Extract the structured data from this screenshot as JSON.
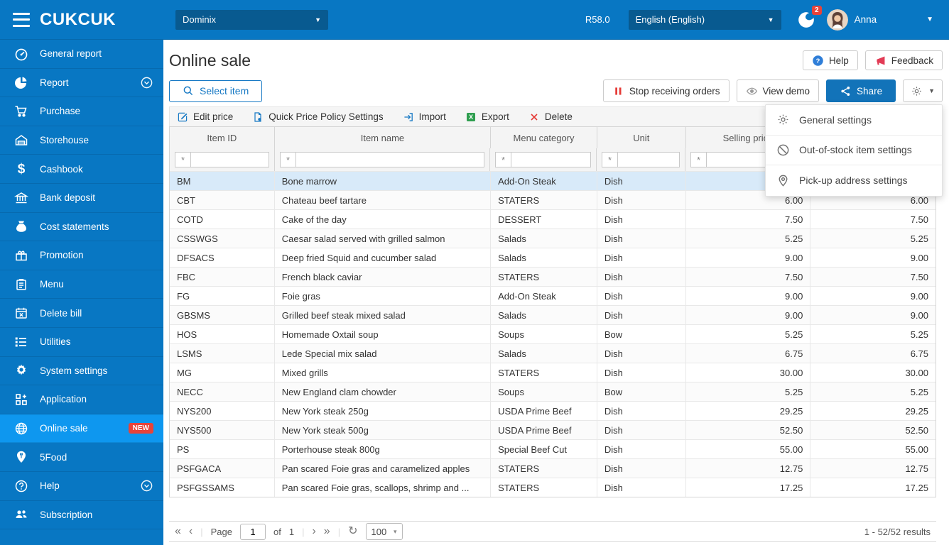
{
  "topbar": {
    "logo": "CUKCUK",
    "branch_selector": "Dominix",
    "version": "R58.0",
    "language_selector": "English (English)",
    "notification_count": "2",
    "user_name": "Anna"
  },
  "sidebar": {
    "items": [
      {
        "label": "General report",
        "icon": "gauge-icon"
      },
      {
        "label": "Report",
        "icon": "pie-chart-icon",
        "chevron": true
      },
      {
        "label": "Purchase",
        "icon": "cart-icon"
      },
      {
        "label": "Storehouse",
        "icon": "warehouse-icon"
      },
      {
        "label": "Cashbook",
        "icon": "dollar-icon"
      },
      {
        "label": "Bank deposit",
        "icon": "bank-icon"
      },
      {
        "label": "Cost statements",
        "icon": "moneybag-icon"
      },
      {
        "label": "Promotion",
        "icon": "gift-icon"
      },
      {
        "label": "Menu",
        "icon": "clipboard-icon"
      },
      {
        "label": "Delete bill",
        "icon": "calendar-x-icon"
      },
      {
        "label": "Utilities",
        "icon": "list-icon"
      },
      {
        "label": "System settings",
        "icon": "gear-icon"
      },
      {
        "label": "Application",
        "icon": "grid-plus-icon"
      },
      {
        "label": "Online sale",
        "icon": "globe-icon",
        "active": true,
        "badge": "NEW"
      },
      {
        "label": "5Food",
        "icon": "pin-fork-icon"
      },
      {
        "label": "Help",
        "icon": "question-circle-icon",
        "chevron": true
      },
      {
        "label": "Subscription",
        "icon": "users-icon"
      }
    ]
  },
  "header": {
    "title": "Online sale",
    "help_label": "Help",
    "feedback_label": "Feedback"
  },
  "actions": {
    "select_item_label": "Select item",
    "stop_orders_label": "Stop receiving orders",
    "view_demo_label": "View demo",
    "share_label": "Share"
  },
  "toolbar": {
    "buttons": [
      {
        "label": "Edit price",
        "icon": "edit-icon"
      },
      {
        "label": "Quick Price Policy Settings",
        "icon": "doc-settings-icon"
      },
      {
        "label": "Import",
        "icon": "import-icon"
      },
      {
        "label": "Export",
        "icon": "excel-icon"
      },
      {
        "label": "Delete",
        "icon": "delete-x-icon"
      }
    ]
  },
  "settings_menu": {
    "items": [
      {
        "label": "General settings",
        "icon": "gear-outline-icon"
      },
      {
        "label": "Out-of-stock item settings",
        "icon": "ban-icon"
      },
      {
        "label": "Pick-up address settings",
        "icon": "pin-icon"
      }
    ]
  },
  "table": {
    "columns": [
      {
        "label": "Item ID",
        "align": "left"
      },
      {
        "label": "Item name",
        "align": "left"
      },
      {
        "label": "Menu category",
        "align": "left"
      },
      {
        "label": "Unit",
        "align": "left"
      },
      {
        "label": "Selling price",
        "align": "right"
      },
      {
        "label": "",
        "align": "right"
      }
    ],
    "filter_operator": "*",
    "selected_row_id": "BM",
    "rows": [
      {
        "id": "BM",
        "name": "Bone marrow",
        "category": "Add-On Steak",
        "unit": "Dish",
        "price": "",
        "price2": ""
      },
      {
        "id": "CBT",
        "name": "Chateau beef tartare",
        "category": "STATERS",
        "unit": "Dish",
        "price": "6.00",
        "price2": "6.00"
      },
      {
        "id": "COTD",
        "name": "Cake of the day",
        "category": "DESSERT",
        "unit": "Dish",
        "price": "7.50",
        "price2": "7.50"
      },
      {
        "id": "CSSWGS",
        "name": "Caesar salad served with grilled salmon",
        "category": "Salads",
        "unit": "Dish",
        "price": "5.25",
        "price2": "5.25"
      },
      {
        "id": "DFSACS",
        "name": "Deep fried Squid and cucumber salad",
        "category": "Salads",
        "unit": "Dish",
        "price": "9.00",
        "price2": "9.00"
      },
      {
        "id": "FBC",
        "name": "French black caviar",
        "category": "STATERS",
        "unit": "Dish",
        "price": "7.50",
        "price2": "7.50"
      },
      {
        "id": "FG",
        "name": "Foie gras",
        "category": "Add-On Steak",
        "unit": "Dish",
        "price": "9.00",
        "price2": "9.00"
      },
      {
        "id": "GBSMS",
        "name": "Grilled beef steak mixed salad",
        "category": "Salads",
        "unit": "Dish",
        "price": "9.00",
        "price2": "9.00"
      },
      {
        "id": "HOS",
        "name": "Homemade Oxtail soup",
        "category": "Soups",
        "unit": "Bow",
        "price": "5.25",
        "price2": "5.25"
      },
      {
        "id": "LSMS",
        "name": "Lede Special mix salad",
        "category": "Salads",
        "unit": "Dish",
        "price": "6.75",
        "price2": "6.75"
      },
      {
        "id": "MG",
        "name": "Mixed grills",
        "category": "STATERS",
        "unit": "Dish",
        "price": "30.00",
        "price2": "30.00"
      },
      {
        "id": "NECC",
        "name": "New England clam chowder",
        "category": "Soups",
        "unit": "Bow",
        "price": "5.25",
        "price2": "5.25"
      },
      {
        "id": "NYS200",
        "name": "New York steak 250g",
        "category": "USDA Prime Beef",
        "unit": "Dish",
        "price": "29.25",
        "price2": "29.25"
      },
      {
        "id": "NYS500",
        "name": "New York steak 500g",
        "category": "USDA Prime Beef",
        "unit": "Dish",
        "price": "52.50",
        "price2": "52.50"
      },
      {
        "id": "PS",
        "name": "Porterhouse steak 800g",
        "category": "Special Beef Cut",
        "unit": "Dish",
        "price": "55.00",
        "price2": "55.00"
      },
      {
        "id": "PSFGACA",
        "name": "Pan scared Foie gras and caramelized apples",
        "category": "STATERS",
        "unit": "Dish",
        "price": "12.75",
        "price2": "12.75"
      },
      {
        "id": "PSFGSSAMS",
        "name": "Pan scared Foie gras, scallops, shrimp and ...",
        "category": "STATERS",
        "unit": "Dish",
        "price": "17.25",
        "price2": "17.25"
      }
    ]
  },
  "pagination": {
    "page_label": "Page",
    "page_value": "1",
    "of_label": "of",
    "total_pages": "1",
    "page_size": "100",
    "results_text": "1 - 52/52 results"
  },
  "colors": {
    "brand_blue": "#0877c3",
    "active_item_blue": "#0e97ef",
    "dark_select_blue": "#085a90",
    "share_button_blue": "#1273b9",
    "badge_red": "#e8433a",
    "excel_green": "#2e9e4f",
    "selected_row_blue": "#d8eaf9"
  }
}
